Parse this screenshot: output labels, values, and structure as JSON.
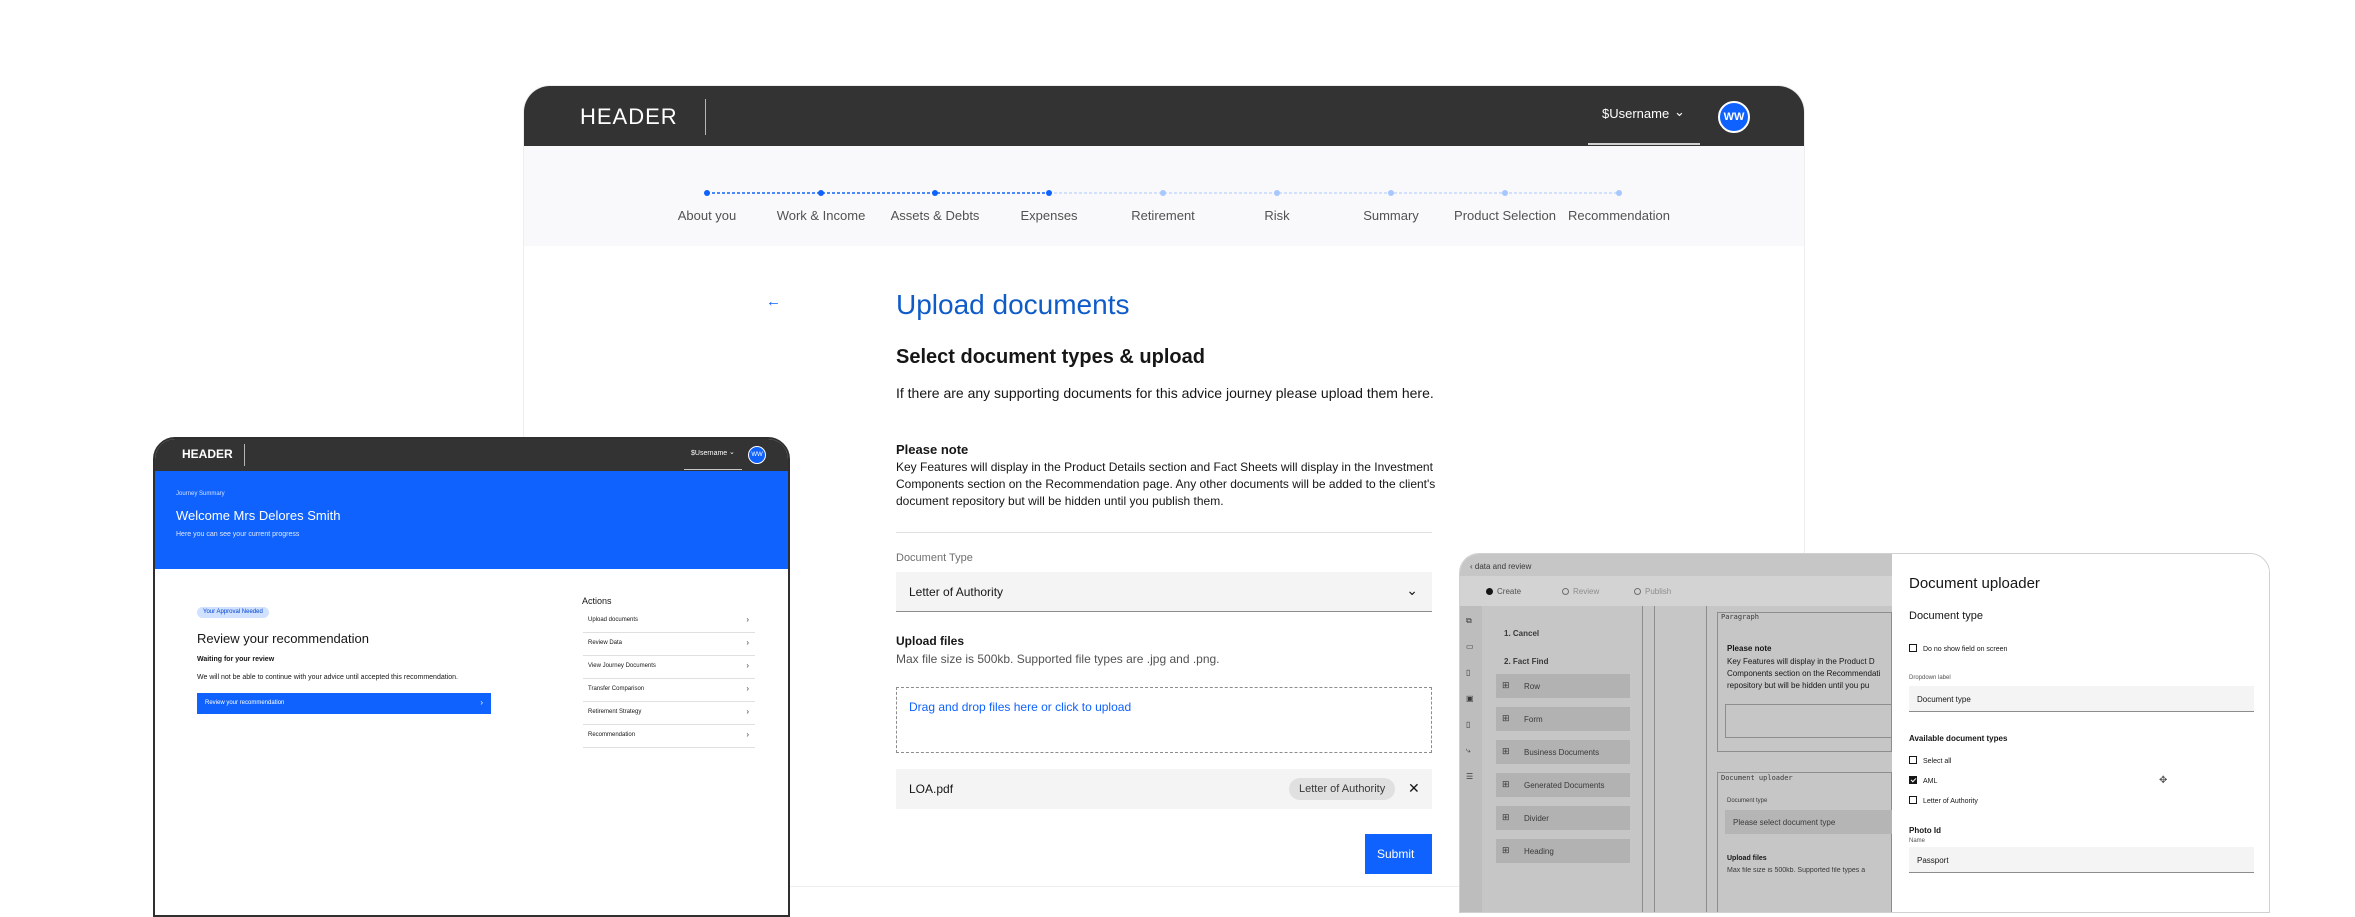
{
  "main": {
    "header": {
      "brand": "HEADER",
      "username": "$Username",
      "avatar_initials": "WW"
    },
    "progress": {
      "steps": [
        {
          "label": "About you",
          "state": "done"
        },
        {
          "label": "Work & Income",
          "state": "done"
        },
        {
          "label": "Assets & Debts",
          "state": "done"
        },
        {
          "label": "Expenses",
          "state": "current"
        },
        {
          "label": "Retirement",
          "state": "todo"
        },
        {
          "label": "Risk",
          "state": "todo"
        },
        {
          "label": "Summary",
          "state": "todo"
        },
        {
          "label": "Product Selection",
          "state": "todo"
        },
        {
          "label": "Recommendation",
          "state": "todo"
        }
      ]
    },
    "back_icon": "arrow-left-icon",
    "title": "Upload documents",
    "subtitle": "Select document types & upload",
    "intro": "If there are any supporting documents for this advice journey please upload them here.",
    "note_heading": "Please note",
    "note_body": "Key Features will display in the Product Details section and Fact Sheets will display in the Investment Components section on the Recommendation page. Any other documents will be added to the client's document repository but will be hidden until you publish them.",
    "document_type": {
      "label": "Document Type",
      "value": "Letter of Authority"
    },
    "upload": {
      "heading": "Upload files",
      "hint": "Max file size is 500kb. Supported file types are .jpg and .png.",
      "dropzone": "Drag and drop files here or click to upload"
    },
    "file": {
      "name": "LOA.pdf",
      "tag": "Letter of Authority"
    },
    "submit_label": "Submit",
    "colors": {
      "primary": "#0f62fe",
      "header_bg": "#333333",
      "title": "#0f5cc9"
    }
  },
  "left": {
    "header": {
      "brand": "HEADER",
      "username": "$Username",
      "avatar_initials": "WW"
    },
    "hero": {
      "crumb": "Journey Summary",
      "welcome": "Welcome Mrs Delores Smith",
      "sub": "Here you can see your current progress"
    },
    "badge": "Your Approval Needed",
    "review_title": "Review your recommendation",
    "waiting": "Waiting for your review",
    "notice": "We will not be able to continue with your advice until accepted this recommendation.",
    "review_button": "Review your recommendation",
    "actions_heading": "Actions",
    "actions": [
      "Upload documents",
      "Review Data",
      "View Journey Documents",
      "Transfer Comparison",
      "Retirement Strategy",
      "Recommendation"
    ]
  },
  "right": {
    "breadcrumb": "data and review",
    "modes": [
      {
        "label": "Create",
        "state": "on"
      },
      {
        "label": "Review",
        "state": "off"
      },
      {
        "label": "Publish",
        "state": "off"
      }
    ],
    "steps": [
      "1. Cancel",
      "2. Fact Find"
    ],
    "palette": [
      "Row",
      "Form",
      "Business Documents",
      "Generated Documents",
      "Divider",
      "Heading"
    ],
    "canvas": {
      "paragraph_tag": "Paragraph",
      "note_heading": "Please note",
      "note_lines": [
        "Key Features will display in the Product D",
        "Components section on the Recommendati",
        "repository but will be hidden until you pu"
      ],
      "uploader_tag": "Document uploader",
      "doc_type_label": "Document type",
      "doc_type_placeholder": "Please select document type",
      "upload_heading": "Upload files",
      "upload_hint": "Max file size is 500kb. Supported file types a"
    },
    "panel": {
      "title": "Document uploader",
      "section": "Document type",
      "no_show": "Do no show field on screen",
      "dropdown_label": "Dropdown label",
      "dropdown_value": "Document type",
      "available_heading": "Available document types",
      "options": [
        {
          "label": "Select all",
          "checked": false
        },
        {
          "label": "AML",
          "checked": true
        },
        {
          "label": "Letter of Authority",
          "checked": false
        }
      ],
      "photo_heading": "Photo Id",
      "photo_label": "Name",
      "photo_value": "Passport"
    }
  }
}
